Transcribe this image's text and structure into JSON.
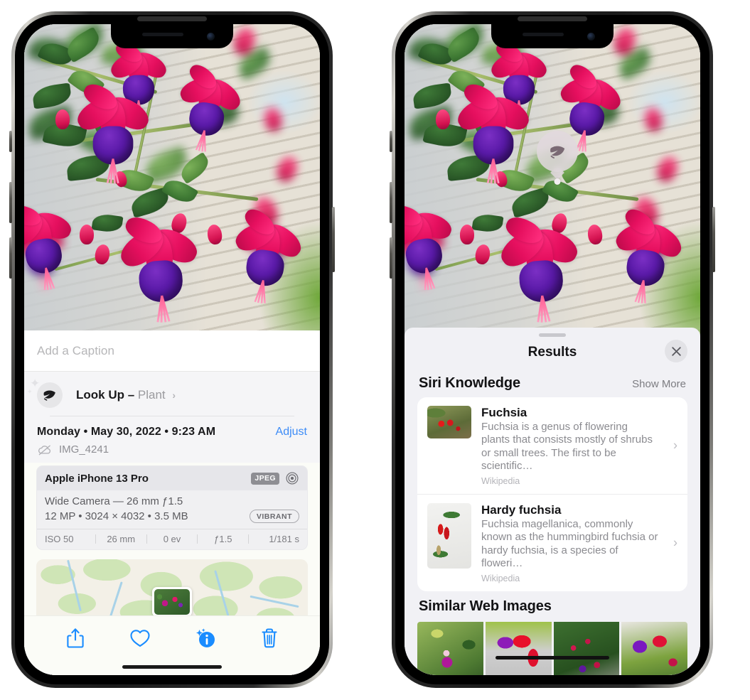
{
  "left_phone": {
    "caption_placeholder": "Add a Caption",
    "lookup": {
      "label": "Look Up",
      "separator": " – ",
      "subject": "Plant",
      "chevron": "›",
      "icon": "leaf-icon"
    },
    "date": "Monday • May 30, 2022 • 9:23 AM",
    "adjust_label": "Adjust",
    "filename": "IMG_4241",
    "cloud_icon": "icloud-slash-icon",
    "exif": {
      "model": "Apple iPhone 13 Pro",
      "format_tag": "JPEG",
      "aperture_icon": "aperture-icon",
      "lens_line": "Wide Camera — 26 mm ƒ1.5",
      "specs_line": "12 MP • 3024 × 4032 • 3.5 MB",
      "style_tag": "VIBRANT",
      "stats": [
        "ISO 50",
        "26 mm",
        "0 ev",
        "ƒ1.5",
        "1/181 s"
      ]
    },
    "toolbar": [
      {
        "name": "share-button",
        "icon": "share-icon"
      },
      {
        "name": "favorite-button",
        "icon": "heart-icon"
      },
      {
        "name": "info-button",
        "icon": "info-sparkle-icon"
      },
      {
        "name": "delete-button",
        "icon": "trash-icon"
      }
    ]
  },
  "right_phone": {
    "visual_lookup_badge": {
      "icon": "leaf-icon"
    },
    "sheet": {
      "title": "Results",
      "close_label": "✕",
      "siri_section": {
        "title": "Siri Knowledge",
        "action": "Show More",
        "items": [
          {
            "title": "Fuchsia",
            "description": "Fuchsia is a genus of flowering plants that consists mostly of shrubs or small trees. The first to be scientific…",
            "source": "Wikipedia",
            "chevron": "›"
          },
          {
            "title": "Hardy fuchsia",
            "description": "Fuchsia magellanica, commonly known as the hummingbird fuchsia or hardy fuchsia, is a species of floweri…",
            "source": "Wikipedia",
            "chevron": "›"
          }
        ]
      },
      "similar_section": {
        "title": "Similar Web Images",
        "thumbnails": [
          "web-image-1",
          "web-image-2",
          "web-image-3",
          "web-image-4"
        ]
      }
    }
  },
  "colors": {
    "accent_blue": "#3d8cf7",
    "sheet_bg": "#f1f1f5",
    "card_bg": "#ffffff",
    "secondary_text": "#8b8b90"
  }
}
